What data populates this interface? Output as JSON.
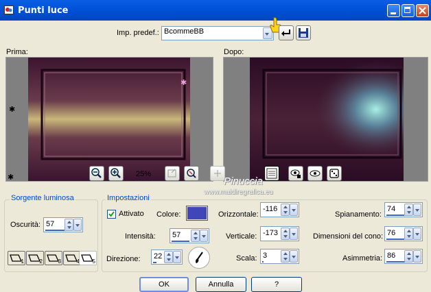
{
  "window": {
    "title": "Punti luce"
  },
  "preset": {
    "label": "Imp. predef.:",
    "value": "BcommeBB"
  },
  "preview": {
    "before_label": "Prima:",
    "after_label": "Dopo:",
    "zoom": "25%"
  },
  "watermark": {
    "line1": "Pinuccia",
    "line2": "www.maidiregrafica.eu"
  },
  "light_source": {
    "group_title": "Sorgente luminosa",
    "darkness_label": "Oscurità:",
    "darkness_value": "57",
    "light_numbers": [
      "1",
      "2",
      "3",
      "4",
      "5"
    ]
  },
  "settings": {
    "group_title": "Impostazioni",
    "enabled_label": "Attivato",
    "color_label": "Colore:",
    "color": "#4046b8",
    "intensity_label": "Intensità:",
    "intensity_value": "57",
    "direction_label": "Direzione:",
    "direction_value": "22",
    "horizontal_label": "Orizzontale:",
    "horizontal_value": "-116",
    "vertical_label": "Verticale:",
    "vertical_value": "-173",
    "scale_label": "Scala:",
    "scale_value": "3",
    "flattening_label": "Spianamento:",
    "flattening_value": "74",
    "cone_label": "Dimensioni del cono:",
    "cone_value": "76",
    "asymmetry_label": "Asimmetria:",
    "asymmetry_value": "86"
  },
  "buttons": {
    "ok": "OK",
    "cancel": "Annulla",
    "help": "?"
  },
  "icons": [
    "app-icon",
    "minimize-icon",
    "maximize-icon",
    "close-icon",
    "reset-icon",
    "save-preset-icon",
    "zoom-out-icon",
    "zoom-in-icon",
    "fit-icon",
    "navigate-icon",
    "move-icon",
    "proof-icon",
    "eye-lock-icon",
    "eye-icon",
    "randomize-icon",
    "hand-pointer-icon",
    "color-brush-icon"
  ]
}
